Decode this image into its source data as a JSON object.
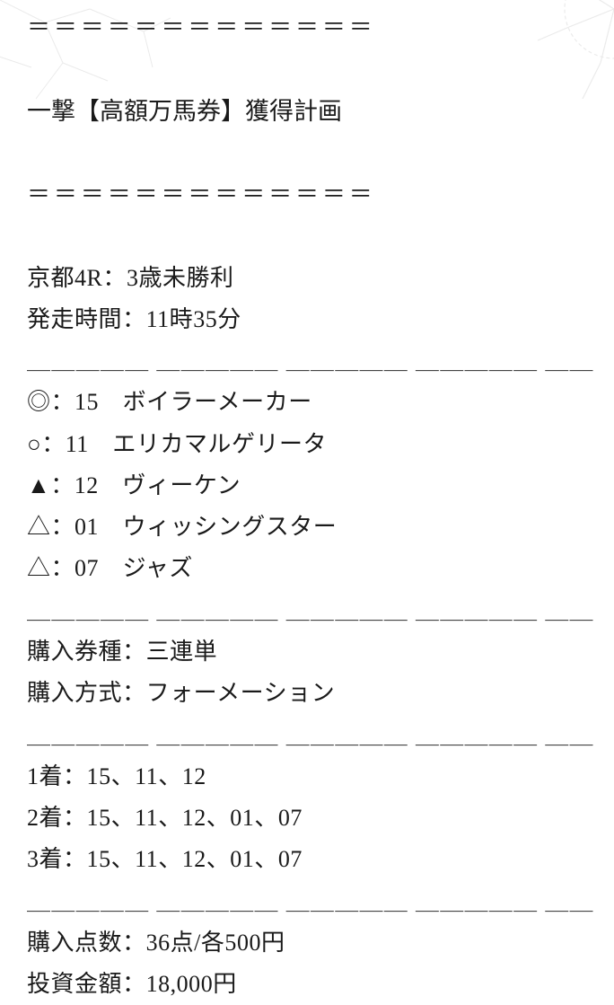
{
  "divider_top": "＝＝＝＝＝＝＝＝＝＝＝＝＝",
  "title": "一撃【高額万馬券】獲得計画",
  "divider_mid": "＝＝＝＝＝＝＝＝＝＝＝＝＝",
  "race_info": {
    "race": "京都4R：3歳未勝利",
    "start_time": "発走時間：11時35分"
  },
  "underline": "＿＿＿＿＿ ＿＿＿＿＿ ＿＿＿＿＿ ＿＿＿＿＿ ＿＿",
  "picks": [
    "◎：15　ボイラーメーカー",
    "○：11　エリカマルゲリータ",
    "▲：12　ヴィーケン",
    "△：01　ウィッシングスター",
    "△：07　ジャズ"
  ],
  "bet_type": {
    "ticket": "購入券種：三連単",
    "method": "購入方式：フォーメーション"
  },
  "positions": [
    "1着：15、11、12",
    "2着：15、11、12、01、07",
    "3着：15、11、12、01、07"
  ],
  "summary": {
    "points": "購入点数：36点/各500円",
    "investment": "投資金額：18,000円"
  }
}
